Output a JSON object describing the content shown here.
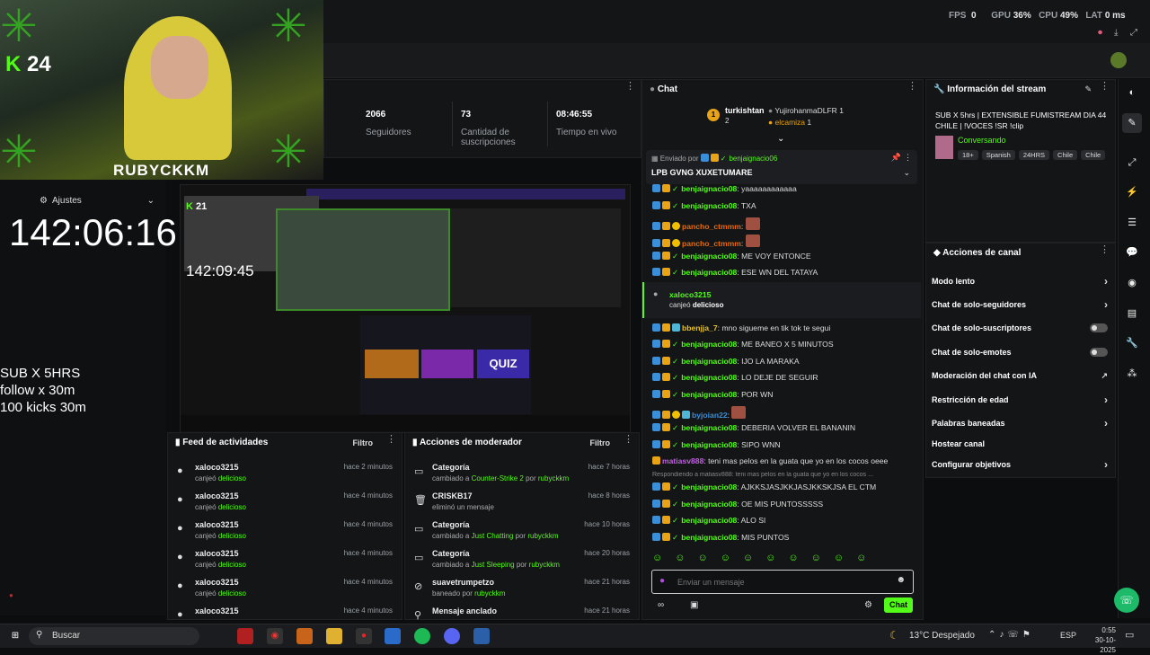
{
  "perf": {
    "fps_label": "FPS",
    "fps": "0",
    "gpu_label": "GPU",
    "gpu": "36%",
    "cpu_label": "CPU",
    "cpu": "49%",
    "lat_label": "LAT",
    "lat": "0 ms"
  },
  "webcam": {
    "kick_count": "24",
    "name_tag": "RUBYCKKM"
  },
  "stats": [
    {
      "value": "2066",
      "label": "Seguidores"
    },
    {
      "value": "73",
      "label": "Cantidad de suscripciones"
    },
    {
      "value": "08:46:55",
      "label": "Tiempo en vivo"
    }
  ],
  "settings": {
    "label": "Ajustes",
    "timer": "142:06:16"
  },
  "overlay_text": [
    "SUB X 5HRS",
    "follow x 30m",
    "100 kicks 30m"
  ],
  "preview": {
    "inner_timer": "142:09:45",
    "inner_kick": "21",
    "quiz_label": "QUIZ"
  },
  "chat": {
    "title": "Chat",
    "leaders": [
      {
        "rank": "1",
        "name": "turkishtan",
        "count": "2"
      },
      {
        "name": "YujirohanmaDLFR",
        "count": "1"
      },
      {
        "name": "elcamiza",
        "count": "1"
      }
    ],
    "pinned": {
      "sent_by": "Enviado por",
      "sent_user": "benjaignacio06",
      "message": "LPB GVNG XUXETUMARE"
    },
    "lines": [
      {
        "user": "benjaignacio08",
        "text": "yaaaaaaaaaaaa"
      },
      {
        "user": "benjaignacio08",
        "text": "TXA"
      },
      {
        "user": "pancho_ctmmm",
        "text": ""
      },
      {
        "user": "pancho_ctmmm",
        "text": ""
      },
      {
        "user": "benjaignacio08",
        "text": "ME VOY ENTONCE"
      },
      {
        "user": "benjaignacio08",
        "text": "ESE WN DEL TATAYA"
      }
    ],
    "redeem": {
      "user": "xaloco3215",
      "text_a": "canjeó",
      "reward": "delicioso"
    },
    "lines2": [
      {
        "user": "bbenjja_7",
        "text": "mno sigueme en tik tok te segui"
      },
      {
        "user": "benjaignacio08",
        "text": "ME BANEO X 5 MINUTOS"
      },
      {
        "user": "benjaignacio08",
        "text": "IJO LA MARAKA"
      },
      {
        "user": "benjaignacio08",
        "text": "LO DEJE DE SEGUIR"
      },
      {
        "user": "benjaignacio08",
        "text": "POR WN"
      },
      {
        "user": "byjoian22",
        "text": ""
      },
      {
        "user": "benjaignacio08",
        "text": "DEBERIA VOLVER EL BANANIN"
      },
      {
        "user": "benjaignacio08",
        "text": "SIPO WNN"
      },
      {
        "user": "matiasv888",
        "text": "teni mas pelos en la guata que yo en los cocos oeee"
      }
    ],
    "reply_hint": "Respondiendo a matiasv888: teni mas pelos en la guata que yo en los cocos ...",
    "lines3": [
      {
        "user": "benjaignacio08",
        "text": "AJKKSJASJKKJASJKKSKJSA EL CTM"
      },
      {
        "user": "benjaignacio08",
        "text": "OE MIS PUNTOSSSSS"
      },
      {
        "user": "benjaignacio08",
        "text": "ALO SI"
      },
      {
        "user": "benjaignacio08",
        "text": "MIS PUNTOS"
      }
    ],
    "input_placeholder": "Enviar un mensaje",
    "send_label": "Chat"
  },
  "stream_info": {
    "title": "Información del stream",
    "stream_title": "SUB X 5hrs | EXTENSIBLE FUMISTREAM DIA 44 CHILE | !VOCES !SR !clip",
    "category": "Conversando",
    "tags": [
      "18+",
      "Spanish",
      "24HRS",
      "Chile",
      "Chile"
    ]
  },
  "channel_actions": {
    "title": "Acciones de canal",
    "items": [
      {
        "label": "Modo lento",
        "kind": "arrow"
      },
      {
        "label": "Chat de solo-seguidores",
        "kind": "arrow"
      },
      {
        "label": "Chat de solo-suscriptores",
        "kind": "toggle"
      },
      {
        "label": "Chat de solo-emotes",
        "kind": "toggle"
      },
      {
        "label": "Moderación del chat con IA",
        "kind": "ext"
      },
      {
        "label": "Restricción de edad",
        "kind": "arrow"
      },
      {
        "label": "Palabras baneadas",
        "kind": "arrow"
      },
      {
        "label": "Hostear canal",
        "kind": "none"
      },
      {
        "label": "Configurar objetivos",
        "kind": "arrow"
      }
    ]
  },
  "activity_feed": {
    "title": "Feed de actividades",
    "filter": "Filtro",
    "rows": [
      {
        "name": "xaloco3215",
        "verb": "canjeó",
        "reward": "delicioso",
        "time": "hace 2 minutos"
      },
      {
        "name": "xaloco3215",
        "verb": "canjeó",
        "reward": "delicioso",
        "time": "hace 4 minutos"
      },
      {
        "name": "xaloco3215",
        "verb": "canjeó",
        "reward": "delicioso",
        "time": "hace 4 minutos"
      },
      {
        "name": "xaloco3215",
        "verb": "canjeó",
        "reward": "delicioso",
        "time": "hace 4 minutos"
      },
      {
        "name": "xaloco3215",
        "verb": "canjeó",
        "reward": "delicioso",
        "time": "hace 4 minutos"
      },
      {
        "name": "xaloco3215",
        "verb": "",
        "reward": "",
        "time": "hace 4 minutos"
      }
    ]
  },
  "mod_actions": {
    "title": "Acciones de moderador",
    "filter": "Filtro",
    "rows": [
      {
        "name": "Categoría",
        "d1": "cambiado a",
        "target": "Counter-Strike 2",
        "d2": "por",
        "by": "rubyckkm",
        "time": "hace 7 horas"
      },
      {
        "name": "CRISKB17",
        "d1": "eliminó un mensaje",
        "target": "",
        "d2": "",
        "by": "",
        "time": "hace 8 horas"
      },
      {
        "name": "Categoría",
        "d1": "cambiado a",
        "target": "Just Chatting",
        "d2": "por",
        "by": "rubyckkm",
        "time": "hace 10 horas"
      },
      {
        "name": "Categoría",
        "d1": "cambiado a",
        "target": "Just Sleeping",
        "d2": "por",
        "by": "rubyckkm",
        "time": "hace 20 horas"
      },
      {
        "name": "suavetrumpetzo",
        "d1": "baneado por",
        "target": "",
        "d2": "",
        "by": "rubyckkm",
        "time": "hace 21 horas"
      },
      {
        "name": "Mensaje anclado",
        "d1": "",
        "target": "",
        "d2": "",
        "by": "",
        "time": "hace 21 horas"
      }
    ]
  },
  "taskbar": {
    "search": "Buscar",
    "weather": "13°C  Despejado",
    "lang": "ESP",
    "time": "0:55",
    "date": "30-10-2025"
  },
  "colors": {
    "accent": "#53fc18",
    "panel": "#141517",
    "bg": "#0b0d0e"
  }
}
